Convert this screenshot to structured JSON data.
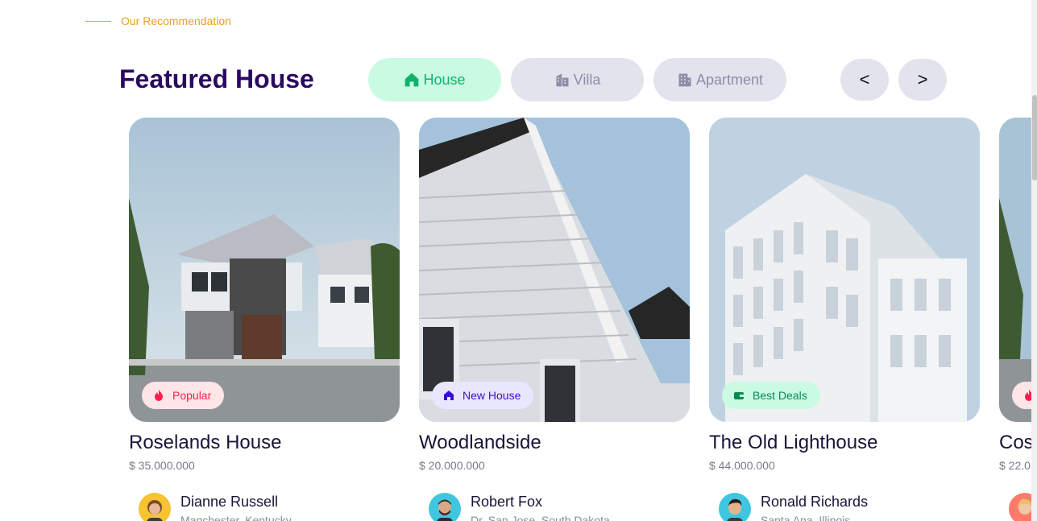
{
  "section": {
    "eyebrow": "Our Recommendation",
    "title": "Featured House"
  },
  "tabs": [
    {
      "label": "House",
      "icon": "home-icon",
      "active": true
    },
    {
      "label": "Villa",
      "icon": "villa-icon",
      "active": false
    },
    {
      "label": "Apartment",
      "icon": "building-icon",
      "active": false
    }
  ],
  "nav": {
    "prev": "<",
    "next": ">"
  },
  "cards": [
    {
      "name": "Roselands House",
      "price": "$ 35.000.000",
      "badge": "Popular",
      "badge_icon": "fire-icon",
      "agent": {
        "name": "Dianne Russell",
        "location": "Manchester, Kentucky"
      }
    },
    {
      "name": "Woodlandside",
      "price": "$ 20.000.000",
      "badge": "New House",
      "badge_icon": "home-icon",
      "agent": {
        "name": "Robert Fox",
        "location": "Dr. San Jose, South Dakota"
      }
    },
    {
      "name": "The Old Lighthouse",
      "price": "$ 44.000.000",
      "badge": "Best Deals",
      "badge_icon": "wallet-icon",
      "agent": {
        "name": "Ronald Richards",
        "location": "Santa Ana, Illinois"
      }
    },
    {
      "name": "Cos",
      "price": "$ 22.0",
      "badge": "",
      "badge_icon": "fire-icon",
      "agent": {
        "name": "",
        "location": ""
      }
    }
  ],
  "colors": {
    "accent_green": "#12b26b",
    "title_purple": "#2a0a5e",
    "eyebrow_orange": "#e8a21b",
    "popular_red": "#ff1d4e",
    "newhouse_purple": "#3a0fcf"
  }
}
